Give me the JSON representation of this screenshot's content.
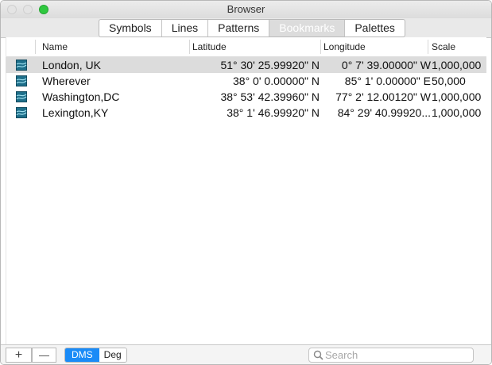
{
  "window": {
    "title": "Browser"
  },
  "tabs": [
    {
      "label": "Symbols",
      "active": false
    },
    {
      "label": "Lines",
      "active": false
    },
    {
      "label": "Patterns",
      "active": false
    },
    {
      "label": "Bookmarks",
      "active": true
    },
    {
      "label": "Palettes",
      "active": false
    }
  ],
  "columns": {
    "name": "Name",
    "latitude": "Latitude",
    "longitude": "Longitude",
    "scale": "Scale"
  },
  "rows": [
    {
      "name": "London, UK",
      "latitude": "51° 30' 25.99920\" N",
      "longitude": "0° 7' 39.00000\" W",
      "scale": "1,000,000",
      "selected": true
    },
    {
      "name": "Wherever",
      "latitude": "38° 0' 0.00000\" N",
      "longitude": "85° 1' 0.00000\" E",
      "scale": "50,000",
      "selected": false
    },
    {
      "name": "Washington,DC",
      "latitude": "38° 53' 42.39960\" N",
      "longitude": "77° 2' 12.00120\" W",
      "scale": "1,000,000",
      "selected": false
    },
    {
      "name": "Lexington,KY",
      "latitude": "38° 1' 46.99920\" N",
      "longitude": "84° 29' 40.99920...",
      "scale": "1,000,000",
      "selected": false
    }
  ],
  "bottom": {
    "add_label": "+",
    "remove_label": "—",
    "dms_label": "DMS",
    "deg_label": "Deg",
    "search_placeholder": "Search"
  },
  "icons": {
    "row_icon": "map-bookmark-icon",
    "search": "magnifier-icon"
  },
  "colors": {
    "accent": "#1a8bf7",
    "selection": "#dcdcdc",
    "zoom_light": "#2fc83f",
    "bookmark_icon": "#1e6f8a"
  }
}
